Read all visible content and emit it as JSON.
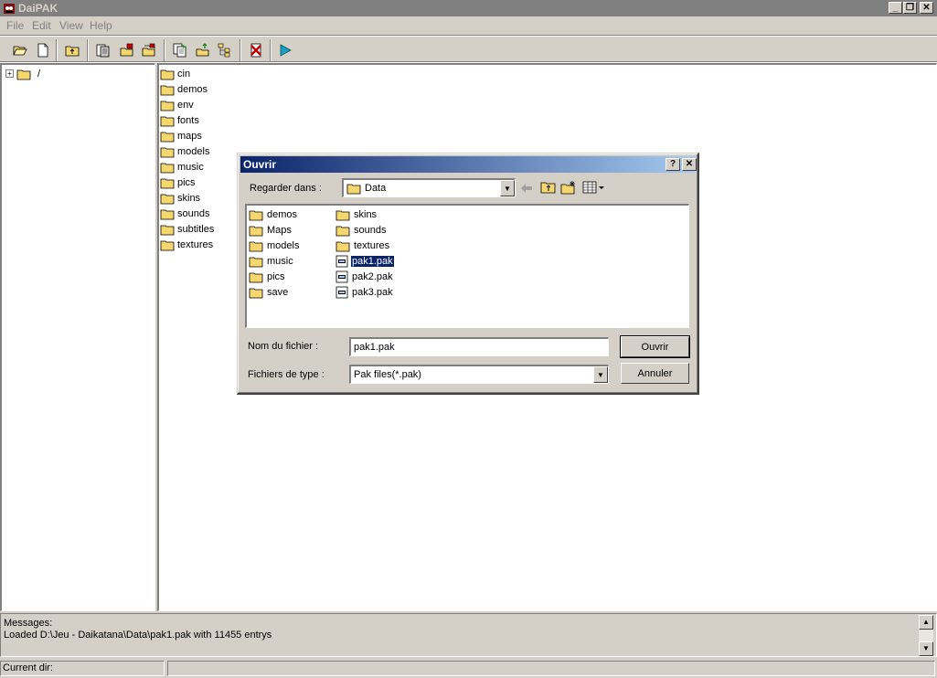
{
  "window": {
    "title": "DaiPAK"
  },
  "menu": {
    "items": [
      "File",
      "Edit",
      "View",
      "Help"
    ]
  },
  "toolbar": {
    "buttons": [
      "open-folder-icon",
      "new-file-icon",
      "folder-up-icon",
      "extract-icon",
      "add-files-icon",
      "add-folder-icon",
      "copy-icon",
      "export-icon",
      "tree-icon",
      "delete-icon",
      "play-icon"
    ]
  },
  "tree": {
    "root_label": "/",
    "expander": "+"
  },
  "folders": [
    "cin",
    "demos",
    "env",
    "fonts",
    "maps",
    "models",
    "music",
    "pics",
    "skins",
    "sounds",
    "subtitles",
    "textures"
  ],
  "dialog": {
    "title": "Ouvrir",
    "help_button": "?",
    "close_button": "✕",
    "look_in_label": "Regarder dans :",
    "look_in_value": "Data",
    "files": [
      {
        "name": "demos",
        "type": "folder"
      },
      {
        "name": "Maps",
        "type": "folder"
      },
      {
        "name": "models",
        "type": "folder"
      },
      {
        "name": "music",
        "type": "folder"
      },
      {
        "name": "pics",
        "type": "folder"
      },
      {
        "name": "save",
        "type": "folder"
      },
      {
        "name": "skins",
        "type": "folder"
      },
      {
        "name": "sounds",
        "type": "folder"
      },
      {
        "name": "textures",
        "type": "folder"
      },
      {
        "name": "pak1.pak",
        "type": "file",
        "selected": true
      },
      {
        "name": "pak2.pak",
        "type": "file"
      },
      {
        "name": "pak3.pak",
        "type": "file"
      }
    ],
    "filename_label": "Nom du fichier :",
    "filename_value": "pak1.pak",
    "filetype_label": "Fichiers de type :",
    "filetype_value": "Pak files(*.pak)",
    "open_button": "Ouvrir",
    "cancel_button": "Annuler"
  },
  "messages": {
    "header": "Messages:",
    "lines": [
      "Loaded D:\\Jeu - Daikatana\\Data\\pak1.pak with 11455 entrys"
    ]
  },
  "status": {
    "current_dir_label": "Current dir:",
    "current_dir_value": ""
  },
  "colors": {
    "title_inactive": "#808080",
    "dialog_title": "#0a246a",
    "folder": "#f5d76e",
    "play": "#1aa0c0",
    "delete": "#c00000"
  }
}
